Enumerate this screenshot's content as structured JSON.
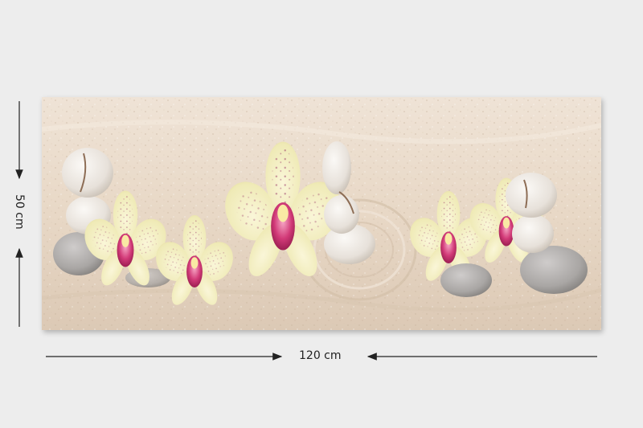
{
  "dimensions": {
    "height_label": "50 cm",
    "width_label": "120 cm"
  },
  "colors": {
    "page_background": "#ededed",
    "sand": "#e8d9c8",
    "orchid_petal": "#f4f1c9",
    "orchid_lip": "#d23a78",
    "stone_white": "#efebe6",
    "stone_grey": "#a8a5a2"
  }
}
